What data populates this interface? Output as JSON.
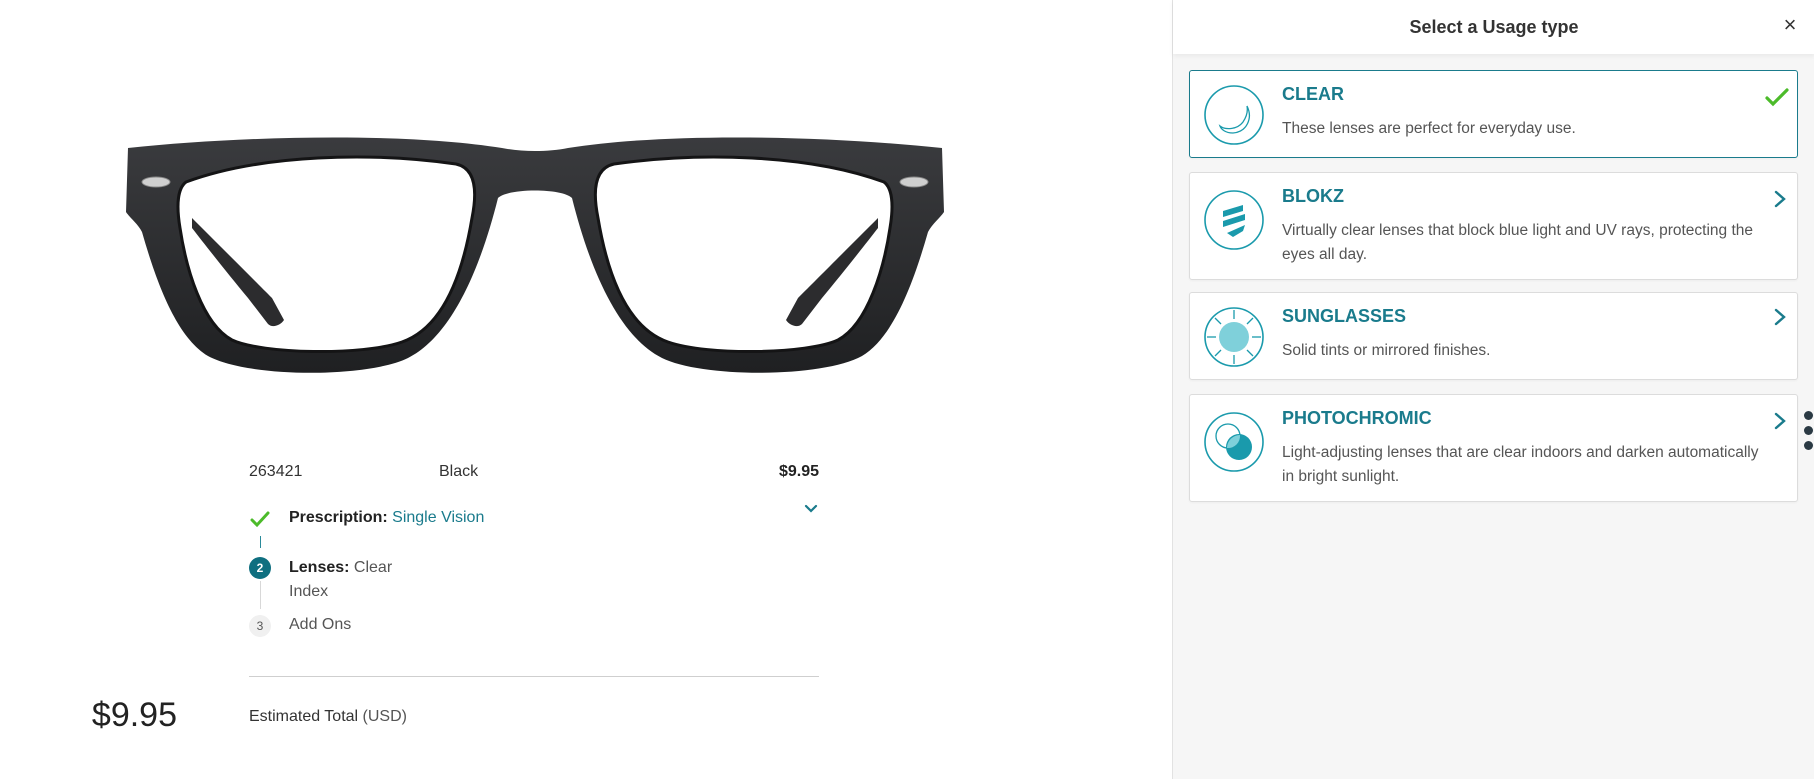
{
  "product": {
    "sku": "263421",
    "color": "Black",
    "price": "$9.95"
  },
  "steps": [
    {
      "number": "",
      "label": "Prescription:",
      "value": "Single Vision",
      "status": "complete"
    },
    {
      "number": "2",
      "label": "Lenses:",
      "value_line1": "Clear",
      "value_line2": "Index",
      "status": "current"
    },
    {
      "number": "3",
      "label": "Add Ons",
      "status": "pending"
    }
  ],
  "total": {
    "label": "Estimated Total",
    "unit": "(USD)",
    "value": "$9.95"
  },
  "panel": {
    "title": "Select a Usage type",
    "close": "×",
    "options": [
      {
        "title": "CLEAR",
        "desc": "These lenses are perfect for everyday use.",
        "icon": "clear-lens-icon",
        "selected": true
      },
      {
        "title": "BLOKZ",
        "desc": "Virtually clear lenses that block blue light and UV rays, protecting the eyes all day.",
        "icon": "blokz-icon",
        "selected": false
      },
      {
        "title": "SUNGLASSES",
        "desc": "Solid tints or mirrored finishes.",
        "icon": "sun-icon",
        "selected": false
      },
      {
        "title": "PHOTOCHROMIC",
        "desc": "Light-adjusting lenses that are clear indoors and darken automatically in bright sunlight.",
        "icon": "photochromic-icon",
        "selected": false
      }
    ]
  },
  "colors": {
    "accent": "#1a7b8c",
    "check": "#4cbb2a",
    "frame": "#2b2b2d"
  }
}
